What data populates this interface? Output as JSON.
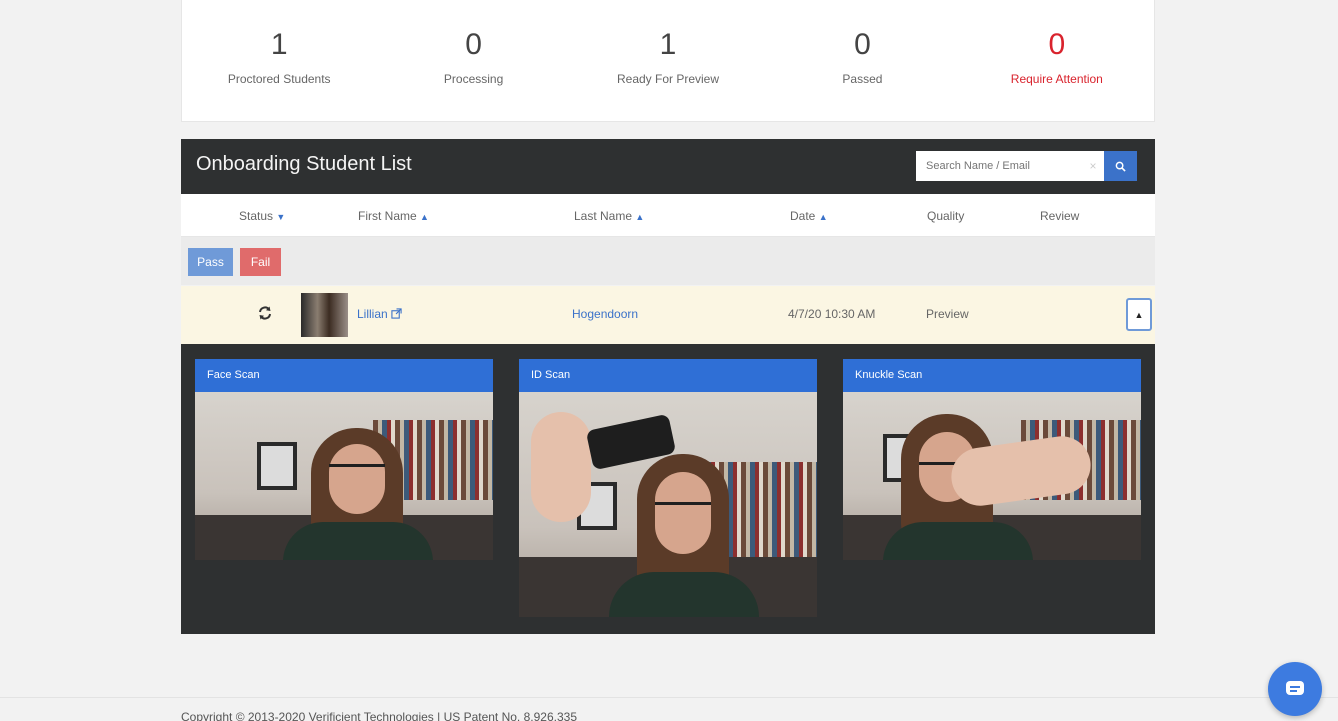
{
  "stats": [
    {
      "value": "1",
      "label": "Proctored Students"
    },
    {
      "value": "0",
      "label": "Processing"
    },
    {
      "value": "1",
      "label": "Ready For Preview"
    },
    {
      "value": "0",
      "label": "Passed"
    },
    {
      "value": "0",
      "label": "Require Attention"
    }
  ],
  "list": {
    "title": "Onboarding Student List",
    "search_placeholder": "Search Name / Email",
    "search_clear": "×",
    "columns": {
      "status": "Status",
      "first_name": "First Name",
      "last_name": "Last Name",
      "date": "Date",
      "quality": "Quality",
      "review": "Review"
    },
    "pass_label": "Pass",
    "fail_label": "Fail"
  },
  "student": {
    "first_name": "Lillian",
    "last_name": "Hogendoorn",
    "date": "4/7/20 10:30 AM",
    "quality": "Preview"
  },
  "scans": [
    {
      "title": "Face Scan"
    },
    {
      "title": "ID Scan"
    },
    {
      "title": "Knuckle Scan"
    }
  ],
  "footer": {
    "copyright": "Copyright © 2013-2020 Verificient Technologies | US Patent No. 8,926,335"
  },
  "colors": {
    "accent": "#3b72c9",
    "alert": "#d9232d",
    "header_dark": "#2e3031",
    "row_highlight": "#fbf6e3"
  },
  "icons": {
    "sort_desc": "caret-down-icon",
    "sort_both": "sort-icon",
    "refresh": "refresh-icon",
    "external": "external-link-icon",
    "collapse": "caret-up-icon",
    "search": "search-icon",
    "chat": "chat-icon"
  }
}
